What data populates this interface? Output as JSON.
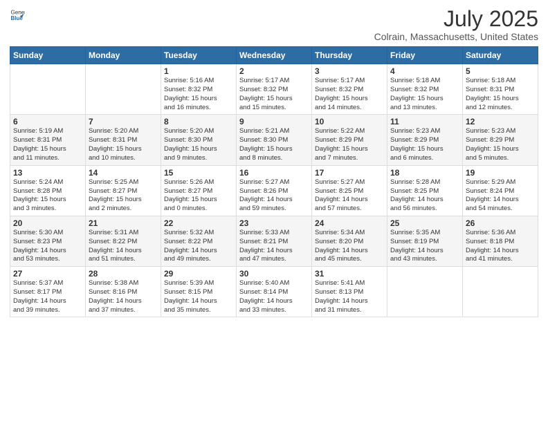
{
  "header": {
    "logo_general": "General",
    "logo_blue": "Blue",
    "title": "July 2025",
    "subtitle": "Colrain, Massachusetts, United States"
  },
  "weekdays": [
    "Sunday",
    "Monday",
    "Tuesday",
    "Wednesday",
    "Thursday",
    "Friday",
    "Saturday"
  ],
  "weeks": [
    [
      {
        "day": "",
        "info": ""
      },
      {
        "day": "",
        "info": ""
      },
      {
        "day": "1",
        "info": "Sunrise: 5:16 AM\nSunset: 8:32 PM\nDaylight: 15 hours\nand 16 minutes."
      },
      {
        "day": "2",
        "info": "Sunrise: 5:17 AM\nSunset: 8:32 PM\nDaylight: 15 hours\nand 15 minutes."
      },
      {
        "day": "3",
        "info": "Sunrise: 5:17 AM\nSunset: 8:32 PM\nDaylight: 15 hours\nand 14 minutes."
      },
      {
        "day": "4",
        "info": "Sunrise: 5:18 AM\nSunset: 8:32 PM\nDaylight: 15 hours\nand 13 minutes."
      },
      {
        "day": "5",
        "info": "Sunrise: 5:18 AM\nSunset: 8:31 PM\nDaylight: 15 hours\nand 12 minutes."
      }
    ],
    [
      {
        "day": "6",
        "info": "Sunrise: 5:19 AM\nSunset: 8:31 PM\nDaylight: 15 hours\nand 11 minutes."
      },
      {
        "day": "7",
        "info": "Sunrise: 5:20 AM\nSunset: 8:31 PM\nDaylight: 15 hours\nand 10 minutes."
      },
      {
        "day": "8",
        "info": "Sunrise: 5:20 AM\nSunset: 8:30 PM\nDaylight: 15 hours\nand 9 minutes."
      },
      {
        "day": "9",
        "info": "Sunrise: 5:21 AM\nSunset: 8:30 PM\nDaylight: 15 hours\nand 8 minutes."
      },
      {
        "day": "10",
        "info": "Sunrise: 5:22 AM\nSunset: 8:29 PM\nDaylight: 15 hours\nand 7 minutes."
      },
      {
        "day": "11",
        "info": "Sunrise: 5:23 AM\nSunset: 8:29 PM\nDaylight: 15 hours\nand 6 minutes."
      },
      {
        "day": "12",
        "info": "Sunrise: 5:23 AM\nSunset: 8:29 PM\nDaylight: 15 hours\nand 5 minutes."
      }
    ],
    [
      {
        "day": "13",
        "info": "Sunrise: 5:24 AM\nSunset: 8:28 PM\nDaylight: 15 hours\nand 3 minutes."
      },
      {
        "day": "14",
        "info": "Sunrise: 5:25 AM\nSunset: 8:27 PM\nDaylight: 15 hours\nand 2 minutes."
      },
      {
        "day": "15",
        "info": "Sunrise: 5:26 AM\nSunset: 8:27 PM\nDaylight: 15 hours\nand 0 minutes."
      },
      {
        "day": "16",
        "info": "Sunrise: 5:27 AM\nSunset: 8:26 PM\nDaylight: 14 hours\nand 59 minutes."
      },
      {
        "day": "17",
        "info": "Sunrise: 5:27 AM\nSunset: 8:25 PM\nDaylight: 14 hours\nand 57 minutes."
      },
      {
        "day": "18",
        "info": "Sunrise: 5:28 AM\nSunset: 8:25 PM\nDaylight: 14 hours\nand 56 minutes."
      },
      {
        "day": "19",
        "info": "Sunrise: 5:29 AM\nSunset: 8:24 PM\nDaylight: 14 hours\nand 54 minutes."
      }
    ],
    [
      {
        "day": "20",
        "info": "Sunrise: 5:30 AM\nSunset: 8:23 PM\nDaylight: 14 hours\nand 53 minutes."
      },
      {
        "day": "21",
        "info": "Sunrise: 5:31 AM\nSunset: 8:22 PM\nDaylight: 14 hours\nand 51 minutes."
      },
      {
        "day": "22",
        "info": "Sunrise: 5:32 AM\nSunset: 8:22 PM\nDaylight: 14 hours\nand 49 minutes."
      },
      {
        "day": "23",
        "info": "Sunrise: 5:33 AM\nSunset: 8:21 PM\nDaylight: 14 hours\nand 47 minutes."
      },
      {
        "day": "24",
        "info": "Sunrise: 5:34 AM\nSunset: 8:20 PM\nDaylight: 14 hours\nand 45 minutes."
      },
      {
        "day": "25",
        "info": "Sunrise: 5:35 AM\nSunset: 8:19 PM\nDaylight: 14 hours\nand 43 minutes."
      },
      {
        "day": "26",
        "info": "Sunrise: 5:36 AM\nSunset: 8:18 PM\nDaylight: 14 hours\nand 41 minutes."
      }
    ],
    [
      {
        "day": "27",
        "info": "Sunrise: 5:37 AM\nSunset: 8:17 PM\nDaylight: 14 hours\nand 39 minutes."
      },
      {
        "day": "28",
        "info": "Sunrise: 5:38 AM\nSunset: 8:16 PM\nDaylight: 14 hours\nand 37 minutes."
      },
      {
        "day": "29",
        "info": "Sunrise: 5:39 AM\nSunset: 8:15 PM\nDaylight: 14 hours\nand 35 minutes."
      },
      {
        "day": "30",
        "info": "Sunrise: 5:40 AM\nSunset: 8:14 PM\nDaylight: 14 hours\nand 33 minutes."
      },
      {
        "day": "31",
        "info": "Sunrise: 5:41 AM\nSunset: 8:13 PM\nDaylight: 14 hours\nand 31 minutes."
      },
      {
        "day": "",
        "info": ""
      },
      {
        "day": "",
        "info": ""
      }
    ]
  ]
}
